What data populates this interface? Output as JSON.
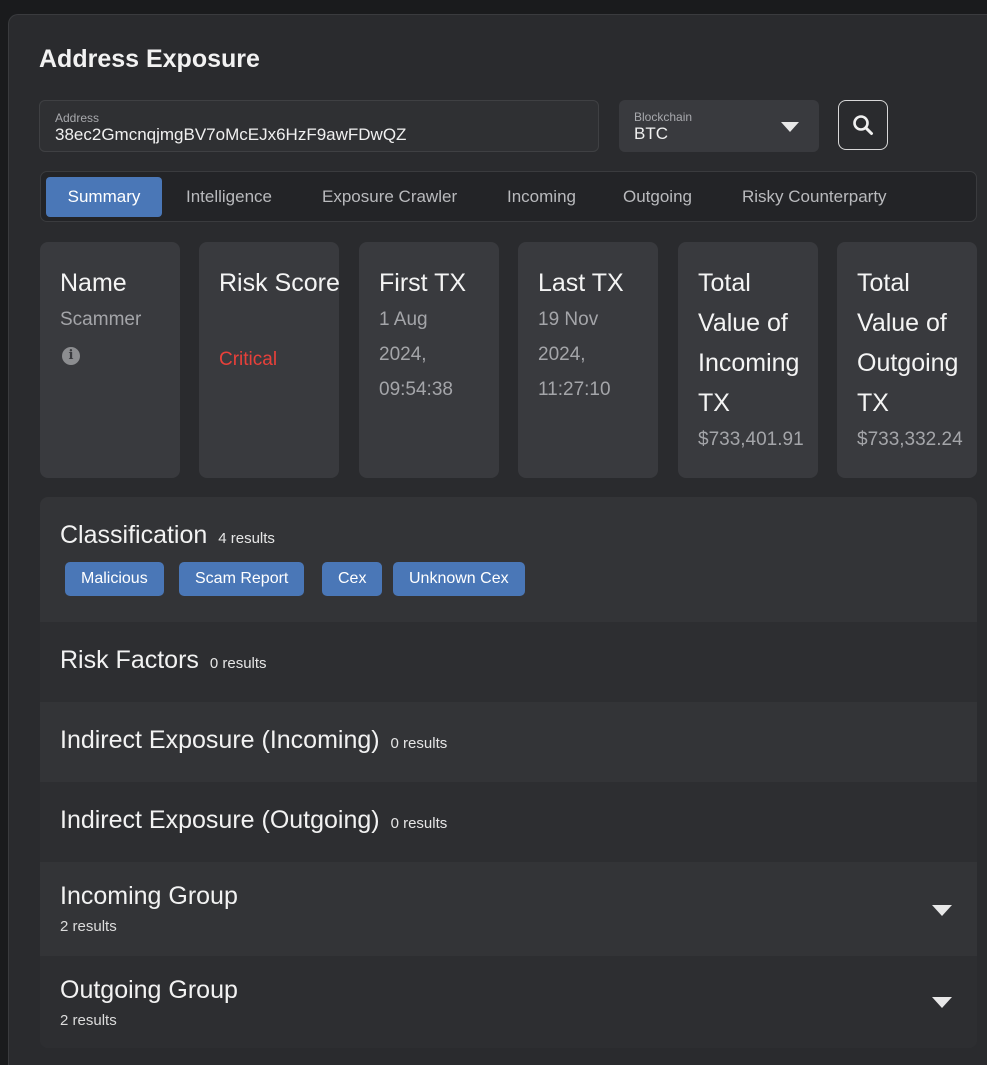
{
  "header": {
    "title": "Address Exposure"
  },
  "address": {
    "label": "Address",
    "value": "38ec2GmcnqjmgBV7oMcEJx6HzF9awFDwQZ"
  },
  "blockchain": {
    "label": "Blockchain",
    "value": "BTC"
  },
  "search": {
    "icon": "search-icon"
  },
  "tabs": [
    {
      "label": "Summary",
      "active": true
    },
    {
      "label": "Intelligence"
    },
    {
      "label": "Exposure Crawler"
    },
    {
      "label": "Incoming"
    },
    {
      "label": "Outgoing"
    },
    {
      "label": "Risky Counterparty"
    }
  ],
  "cards": {
    "name": {
      "title": "Name",
      "value": "Scammer",
      "icon": "info-icon"
    },
    "risk": {
      "title": "Risk Score",
      "value": "Critical",
      "color": "#e8403a"
    },
    "first_tx": {
      "title": "First TX",
      "value": "1 Aug 2024, 09:54:38"
    },
    "last_tx": {
      "title": "Last TX",
      "value": "19 Nov 2024, 11:27:10"
    },
    "incoming": {
      "title": "Total Value of Incoming TX",
      "value": "$733,401.91"
    },
    "outgoing": {
      "title": "Total Value of Outgoing TX",
      "value": "$733,332.24"
    }
  },
  "sections": {
    "classification": {
      "title": "Classification",
      "count": "4 results",
      "tags": [
        "Malicious",
        "Scam Report",
        "Cex",
        "Unknown Cex"
      ]
    },
    "risk_factors": {
      "title": "Risk Factors",
      "count": "0 results"
    },
    "indirect_incoming": {
      "title": "Indirect Exposure (Incoming)",
      "count": "0 results"
    },
    "indirect_outgoing": {
      "title": "Indirect Exposure (Outgoing)",
      "count": "0 results"
    },
    "incoming_group": {
      "title": "Incoming Group",
      "count": "2 results"
    },
    "outgoing_group": {
      "title": "Outgoing Group",
      "count": "2 results"
    }
  },
  "colors": {
    "accent": "#4a77b7",
    "critical": "#e8403a",
    "background": "#2a2b2e"
  }
}
